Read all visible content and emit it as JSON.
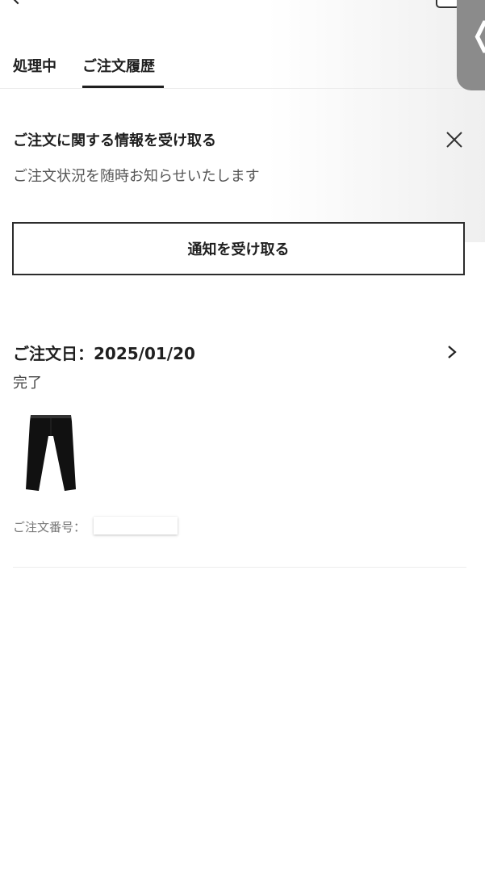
{
  "tabs": [
    {
      "label": "処理中",
      "active": false
    },
    {
      "label": "ご注文履歴",
      "active": true
    }
  ],
  "notice": {
    "title": "ご注文に関する情報を受け取る",
    "description": "ご注文状況を随時お知らせいたします",
    "button_label": "通知を受け取る",
    "close_icon": "close-icon"
  },
  "order": {
    "date_label": "ご注文日：2025/01/20",
    "status": "完了",
    "number_label": "ご注文番号：",
    "product_icon": "pants-image",
    "chevron_icon": "chevron-right-icon"
  },
  "side_handle": {
    "icon": "chevron-left-icon"
  },
  "colors": {
    "text": "#1f1f1f",
    "secondary_text": "#555555",
    "handle": "#8b8b8b",
    "border": "#2c2c2c",
    "divider": "#ebebeb"
  }
}
